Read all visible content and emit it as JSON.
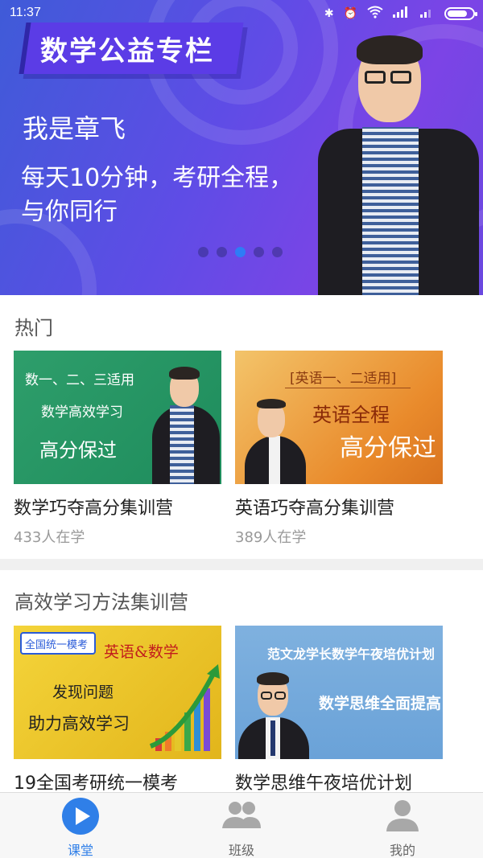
{
  "status_bar": {
    "time": "11:37"
  },
  "banner": {
    "tag": "数学公益专栏",
    "line1": "我是章飞",
    "line2": "每天10分钟，考研全程，",
    "line3": "与你同行",
    "carousel_count": 5,
    "carousel_active_index": 2
  },
  "hot_section": {
    "title": "热门",
    "cards": [
      {
        "thumb_line1": "数一、二、三适用",
        "thumb_line2": "数学高效学习",
        "thumb_line3": "高分保过",
        "title": "数学巧夺高分集训营",
        "learners": "433人在学"
      },
      {
        "thumb_line1": "[英语一、二适用]",
        "thumb_line2": "英语全程",
        "thumb_line3": "高分保过",
        "title": "英语巧夺高分集训营",
        "learners": "389人在学"
      }
    ]
  },
  "method_section": {
    "title": "高效学习方法集训营",
    "cards": [
      {
        "thumb_badge": "全国统一模考",
        "thumb_line1": "英语&数学",
        "thumb_line2": "发现问题",
        "thumb_line3": "助力高效学习",
        "title": "19全国考研统一模考"
      },
      {
        "thumb_line1": "范文龙学长数学午夜培优计划",
        "thumb_line2": "数学思维全面提高",
        "title": "数学思维午夜培优计划"
      }
    ]
  },
  "bottom_nav": {
    "items": [
      {
        "label": "课堂",
        "icon": "play-circle-icon",
        "active": true
      },
      {
        "label": "班级",
        "icon": "group-icon",
        "active": false
      },
      {
        "label": "我的",
        "icon": "user-icon",
        "active": false
      }
    ],
    "accent_color": "#2f7fe8"
  }
}
